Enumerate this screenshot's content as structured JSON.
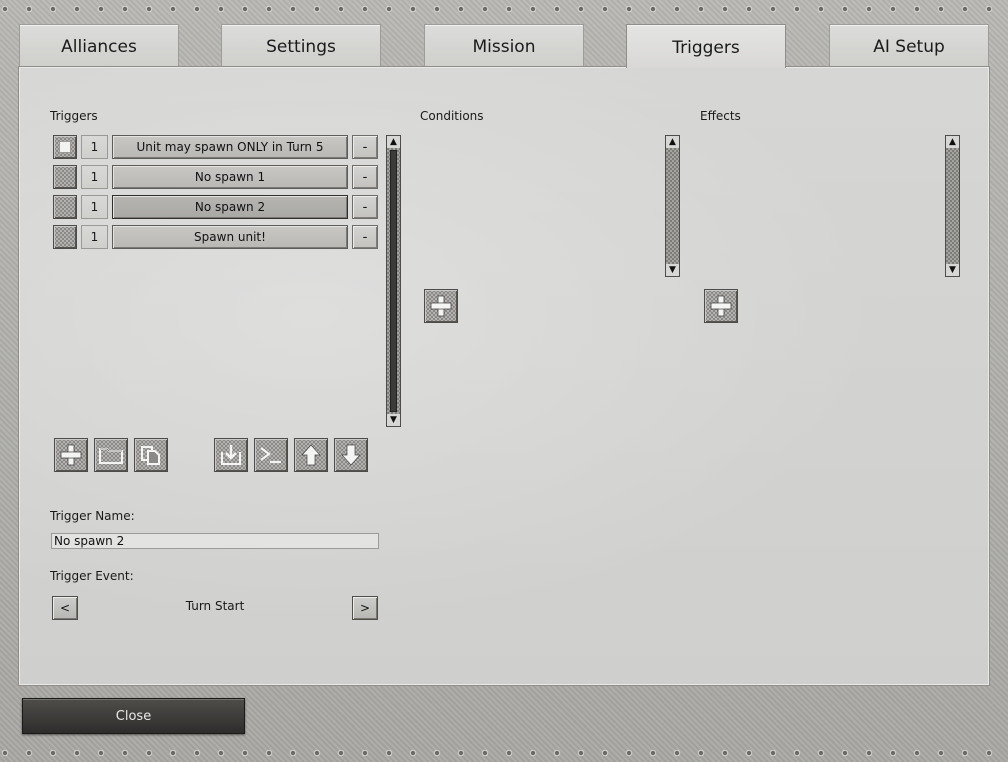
{
  "tabs": [
    {
      "label": "Alliances"
    },
    {
      "label": "Settings"
    },
    {
      "label": "Mission"
    },
    {
      "label": "Triggers",
      "active": true
    },
    {
      "label": "AI Setup"
    }
  ],
  "sections": {
    "triggers": "Triggers",
    "conditions": "Conditions",
    "effects": "Effects"
  },
  "triggers": [
    {
      "count": "1",
      "name": "Unit may spawn ONLY in Turn 5",
      "remove": "-"
    },
    {
      "count": "1",
      "name": "No spawn 1",
      "remove": "-"
    },
    {
      "count": "1",
      "name": "No spawn 2",
      "remove": "-"
    },
    {
      "count": "1",
      "name": "Spawn unit!",
      "remove": "-"
    }
  ],
  "trigger_name": {
    "label": "Trigger Name:",
    "value": "No spawn 2"
  },
  "trigger_event": {
    "label": "Trigger Event:",
    "prev": "<",
    "value": "Turn Start",
    "next": ">"
  },
  "close_label": "Close",
  "colors": {
    "panel": "#d3d3d1",
    "close_bg": "#3a3937",
    "frame": "#b1b0ac"
  }
}
